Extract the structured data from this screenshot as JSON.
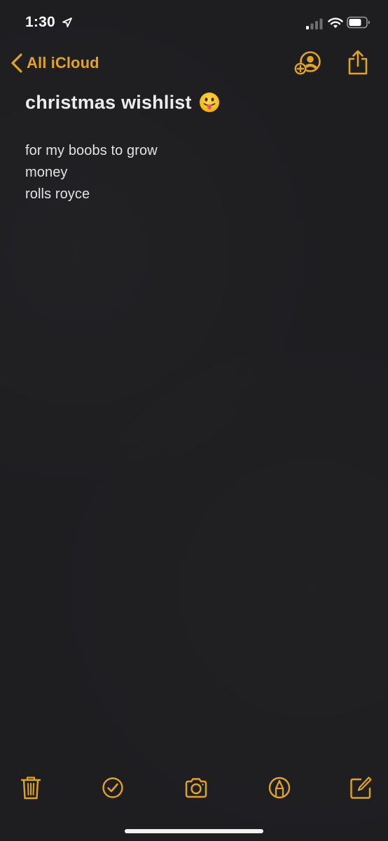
{
  "status_bar": {
    "time": "1:30",
    "icons": [
      "location-arrow-icon",
      "cellular-signal-icon",
      "wifi-icon",
      "battery-icon"
    ]
  },
  "navigation": {
    "back_label": "All iCloud",
    "icons": [
      "chevron-left-icon",
      "add-person-icon",
      "share-icon"
    ]
  },
  "note": {
    "title": "christmas wishlist",
    "title_emoji": "face-with-tongue-emoji",
    "lines": [
      "for my boobs to grow",
      "money",
      "rolls royce"
    ]
  },
  "toolbar": {
    "icons": [
      "trash-icon",
      "checklist-icon",
      "camera-icon",
      "markup-icon",
      "compose-icon"
    ]
  },
  "colors": {
    "background": "#1e1e21",
    "accent": "#e0a323",
    "text": "#e6e6e6"
  }
}
